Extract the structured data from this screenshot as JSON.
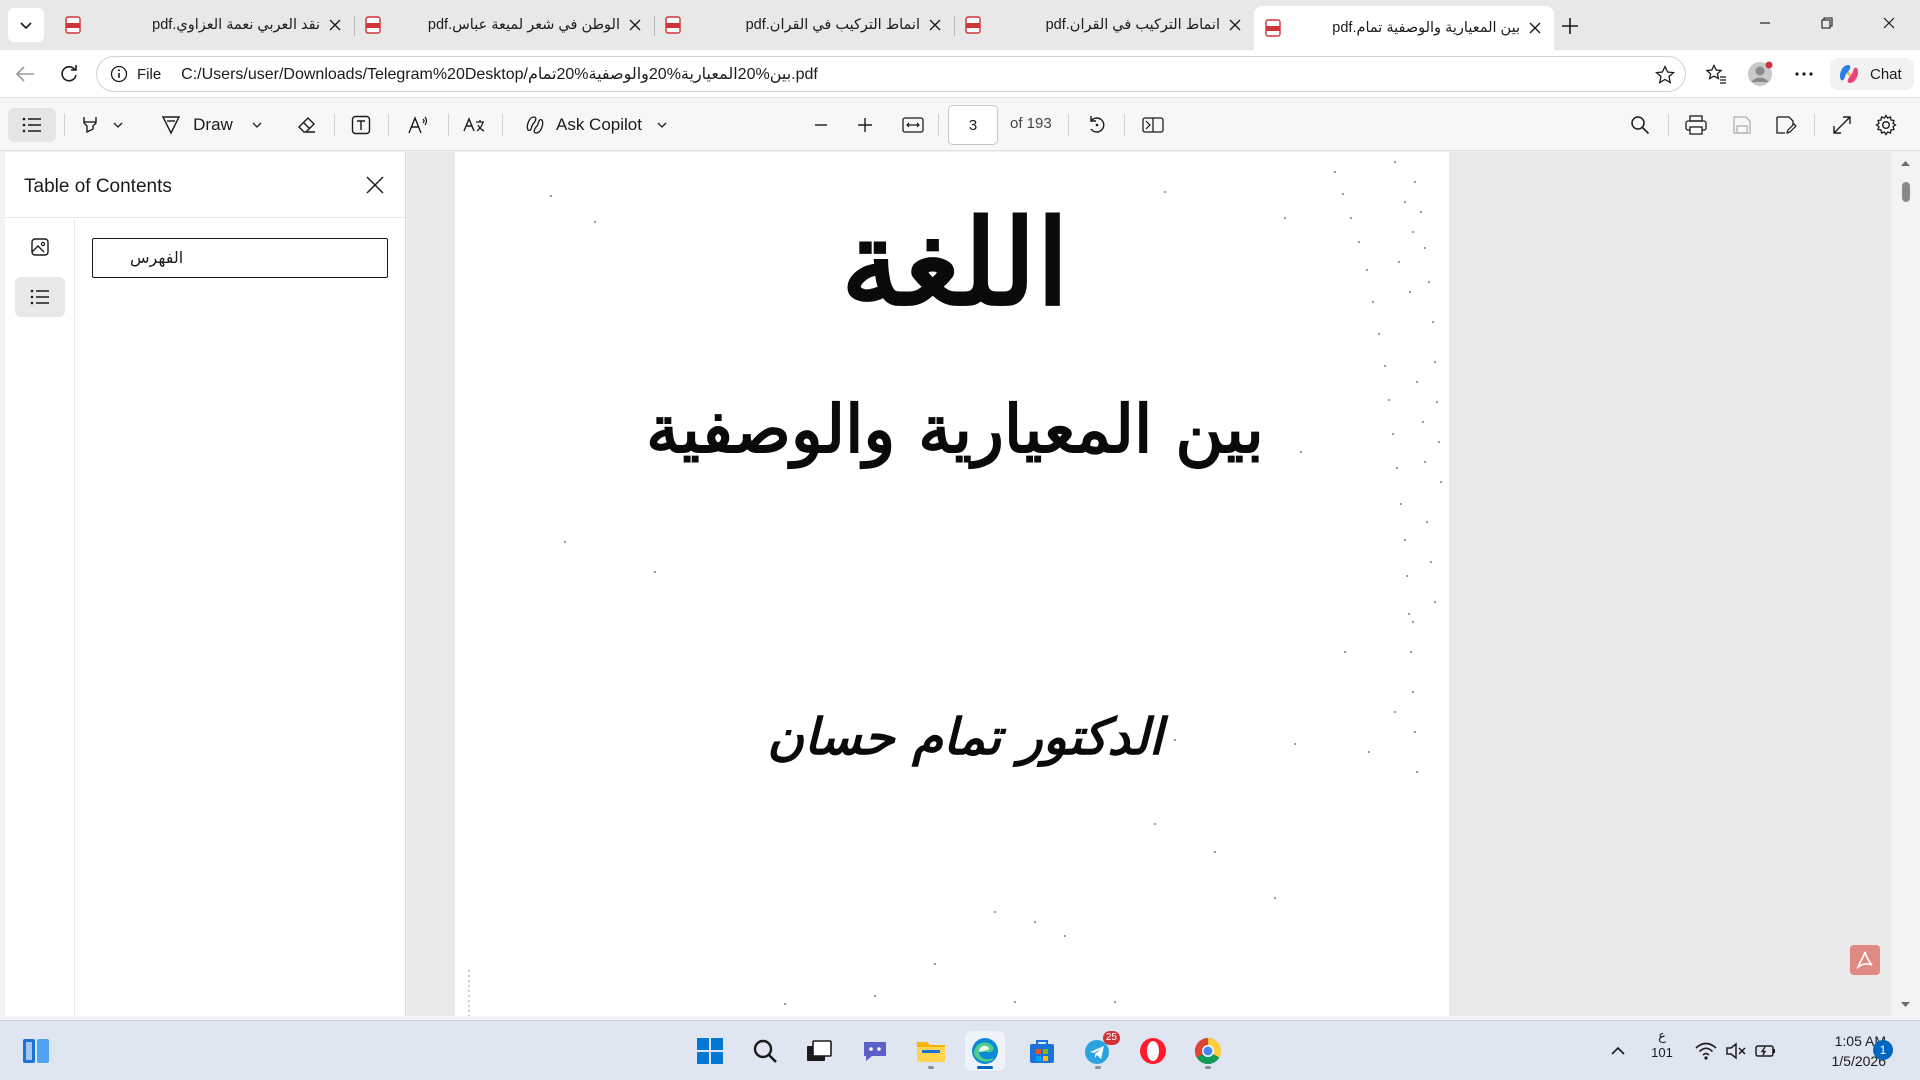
{
  "tabs": [
    {
      "title": "نقد العربي نعمة العزاوي.pdf",
      "active": false
    },
    {
      "title": "الوطن في شعر لميعة عباس.pdf",
      "active": false
    },
    {
      "title": "انماط التركيب في القران.pdf",
      "active": false
    },
    {
      "title": "انماط التركيب في القران.pdf",
      "active": false
    },
    {
      "title": "بين المعيارية والوصفية تمام.pdf",
      "active": true
    }
  ],
  "address_bar": {
    "scheme_label": "File",
    "url": "C:/Users/user/Downloads/Telegram%20Desktop/بين%20المعيارية%20والوصفية%20تمام.pdf"
  },
  "chat": {
    "label": "Chat"
  },
  "pdf_toolbar": {
    "draw_label": "Draw",
    "copilot_label": "Ask Copilot",
    "current_page": "3",
    "page_count_label": "of 193"
  },
  "toc": {
    "title": "Table of Contents",
    "items": [
      "الفهرس"
    ]
  },
  "document": {
    "title_line1": "اللغة",
    "title_line2": "بين المعيارية والوصفية",
    "author": "الدكتور تمام حسان"
  },
  "taskbar": {
    "keyboard_lang": "ع",
    "keyboard_sub": "101",
    "telegram_badge": "25",
    "time": "1:05 AM",
    "date": "1/5/2026",
    "notification_count": "1"
  },
  "colors": {
    "accent": "#0067c0",
    "pdf_red": "#d13438",
    "acrobat": "#e08a84"
  }
}
